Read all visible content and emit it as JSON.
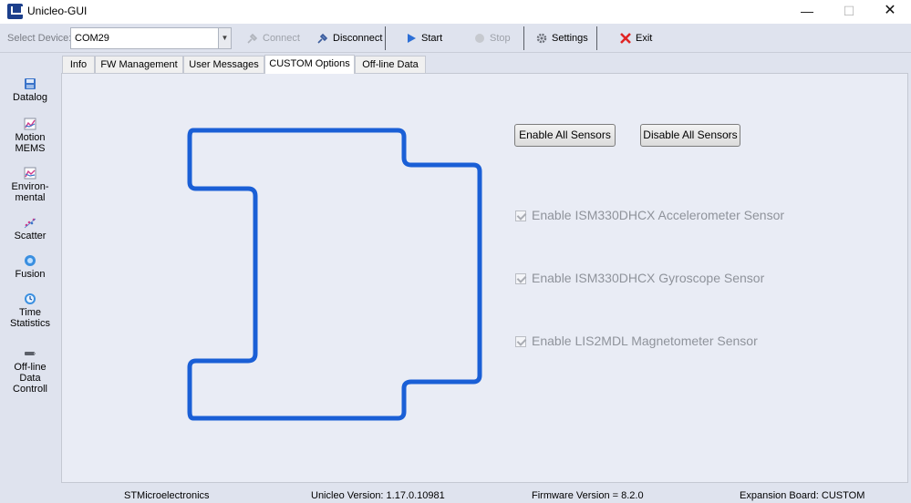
{
  "app": {
    "title": "Unicleo-GUI"
  },
  "window_controls": {
    "minimize": "—",
    "maximize": "☐",
    "close": "✕"
  },
  "toolbar": {
    "select_label": "Select Device:",
    "device_value": "COM29",
    "connect": "Connect",
    "disconnect": "Disconnect",
    "start": "Start",
    "stop": "Stop",
    "settings": "Settings",
    "exit": "Exit"
  },
  "sidebar": {
    "datalog": "Datalog",
    "motion_1": "Motion",
    "motion_2": "MEMS",
    "env_1": "Environ-",
    "env_2": "mental",
    "scatter": "Scatter",
    "fusion": "Fusion",
    "time_1": "Time",
    "time_2": "Statistics",
    "offline_1": "Off-line",
    "offline_2": "Data",
    "offline_3": "Controll"
  },
  "tabs": [
    "Info",
    "FW Management",
    "User Messages",
    "CUSTOM Options",
    "Off-line Data"
  ],
  "active_tab": "CUSTOM Options",
  "custom": {
    "enable_all": "Enable All Sensors",
    "disable_all": "Disable All Sensors",
    "sensors": [
      {
        "label": "Enable ISM330DHCX Accelerometer Sensor",
        "checked": true,
        "enabled": false
      },
      {
        "label": "Enable ISM330DHCX Gyroscope Sensor",
        "checked": true,
        "enabled": false
      },
      {
        "label": "Enable LIS2MDL Magnetometer Sensor",
        "checked": true,
        "enabled": false
      }
    ]
  },
  "status": {
    "company": "STMicroelectronics",
    "version": "Unicleo Version:  1.17.0.10981",
    "firmware": "Firmware Version = 8.2.0",
    "board": "Expansion Board: CUSTOM"
  },
  "colors": {
    "board_outline": "#1a5fd6",
    "toolbar_bg": "#dfe3ee",
    "content_bg": "#e9ecf5"
  }
}
